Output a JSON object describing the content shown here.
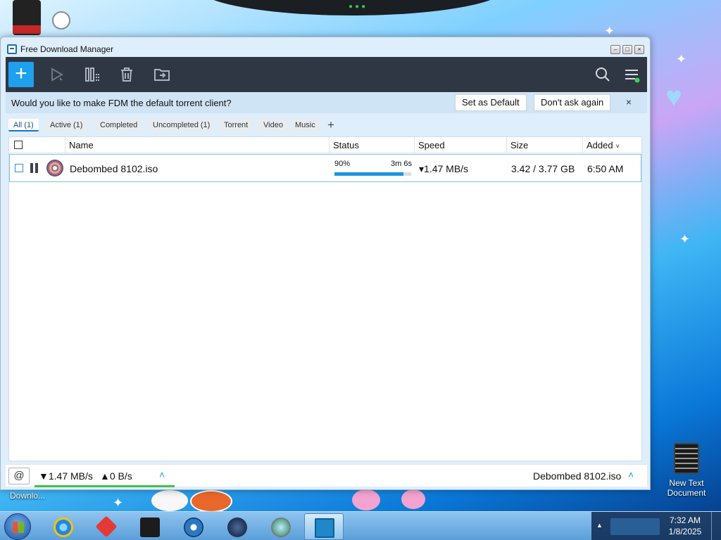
{
  "window": {
    "title": "Free Download Manager",
    "controls": {
      "minimize": "–",
      "maximize": "□",
      "close": "×"
    }
  },
  "toolbar": {
    "add_label": "+",
    "icons": [
      "add-download-icon",
      "resume-icon",
      "columns-icon",
      "delete-icon",
      "move-folder-icon",
      "search-icon",
      "menu-icon"
    ]
  },
  "banner": {
    "text": "Would you like to make FDM the default torrent client?",
    "set_default": "Set as Default",
    "dont_ask": "Don't ask again",
    "close": "×"
  },
  "filters": {
    "tabs": [
      "All (1)",
      "Active (1)",
      "Completed",
      "Uncompleted (1)",
      "Torrent",
      "Video",
      "Music"
    ],
    "active_index": 0,
    "add": "+"
  },
  "table": {
    "columns": [
      "Name",
      "Status",
      "Speed",
      "Size",
      "Added"
    ],
    "sort_indicator": "˅",
    "rows": [
      {
        "name": "Debombed 8102.iso",
        "status_percent": "90%",
        "eta": "3m 6s",
        "progress": 0.9,
        "speed": "▾1.47 MB/s",
        "size": "3.42 / 3.77 GB",
        "added": "6:50 AM"
      }
    ]
  },
  "footer": {
    "download_speed": "▼1.47 MB/s",
    "upload_speed": "▲0 B/s",
    "current_file": "Debombed 8102.iso",
    "chevron": "˄"
  },
  "desktop": {
    "icons": [
      {
        "label": "Downlo..."
      },
      {
        "label": "New Text Document"
      }
    ]
  },
  "taskbar": {
    "apps": [
      "internet-explorer",
      "red-cube-app",
      "black-box-app",
      "media-player",
      "dark-globe-app",
      "browser-globe-app",
      "free-download-manager"
    ],
    "clock_time": "7:32 AM",
    "clock_date": "1/8/2025"
  },
  "colors": {
    "accent": "#1ea0ef",
    "toolbar_bg": "#303744",
    "banner_bg": "#cfe4f5",
    "progress": "#1f95e0",
    "speed_underline": "#44c04a"
  }
}
